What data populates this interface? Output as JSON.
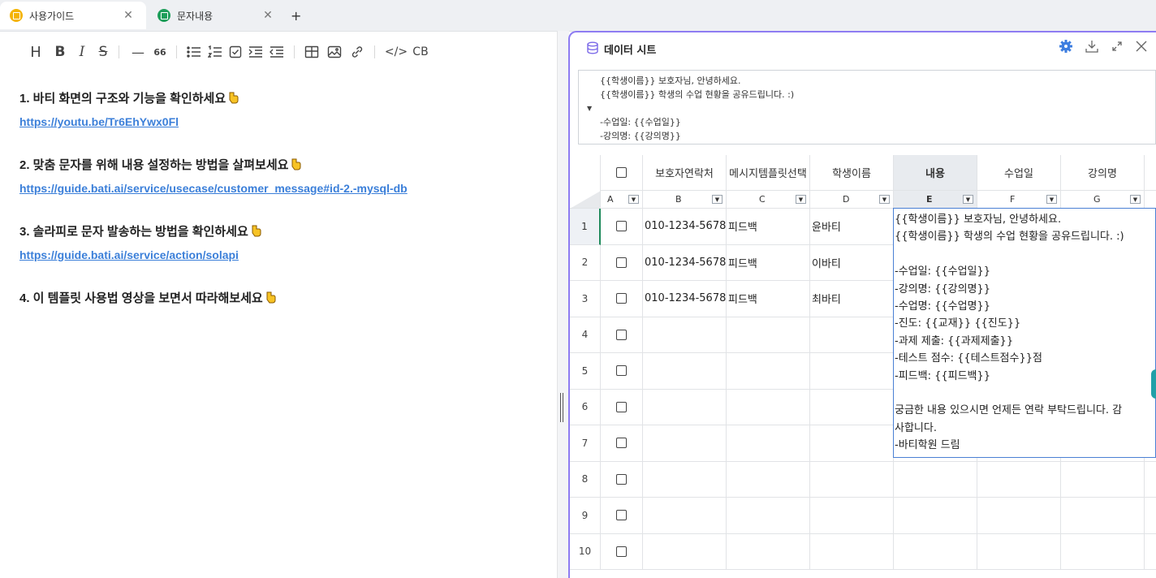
{
  "tabs": [
    {
      "label": "사용가이드",
      "icon": "doc-icon",
      "color": "#f4b400",
      "active": true
    },
    {
      "label": "문자내용",
      "icon": "sheet-icon",
      "color": "#1e9e5a",
      "active": false
    }
  ],
  "toolbar": {
    "heading": "H",
    "bold": "B",
    "italic": "I",
    "strike": "S",
    "hr": "—",
    "quote": "66",
    "code": "</>",
    "codeblock": "CB"
  },
  "doc": {
    "items": [
      {
        "title": "1. 바티 화면의 구조와 기능을 확인하세요",
        "link": "https://youtu.be/Tr6EhYwx0Fl"
      },
      {
        "title": "2. 맞춤 문자를 위해 내용 설정하는 방법을 살펴보세요",
        "link": "https://guide.bati.ai/service/usecase/customer_message#id-2.-mysql-db"
      },
      {
        "title": "3. 솔라피로 문자 발송하는 방법을 확인하세요",
        "link": "https://guide.bati.ai/service/action/solapi"
      },
      {
        "title": "4. 이 템플릿 사용법 영상을 보면서 따라해보세요",
        "link": ""
      }
    ]
  },
  "panel": {
    "title": "데이터 시트",
    "accent": "#8e7cf2",
    "template_lines": [
      "{{학생이름}} 보호자님, 안녕하세요.",
      "{{학생이름}} 학생의 수업 현황을 공유드립니다. :)",
      "",
      "-수업일: {{수업일}}",
      "-강의명: {{강의명}}"
    ]
  },
  "sheet": {
    "headers": [
      "",
      "보호자연락처",
      "메시지템플릿선택",
      "학생이름",
      "내용",
      "수업일",
      "강의명"
    ],
    "letters": [
      "A",
      "B",
      "C",
      "D",
      "E",
      "F",
      "G"
    ],
    "selected_col": "E",
    "rows": [
      {
        "num": "1",
        "phone": "010-1234-5678",
        "template": "피드백",
        "name": "윤바티"
      },
      {
        "num": "2",
        "phone": "010-1234-5678",
        "template": "피드백",
        "name": "이바티"
      },
      {
        "num": "3",
        "phone": "010-1234-5678",
        "template": "피드백",
        "name": "최바티"
      },
      {
        "num": "4",
        "phone": "",
        "template": "",
        "name": ""
      },
      {
        "num": "5",
        "phone": "",
        "template": "",
        "name": ""
      },
      {
        "num": "6",
        "phone": "",
        "template": "",
        "name": ""
      },
      {
        "num": "7",
        "phone": "",
        "template": "",
        "name": ""
      },
      {
        "num": "8",
        "phone": "",
        "template": "",
        "name": ""
      },
      {
        "num": "9",
        "phone": "",
        "template": "",
        "name": ""
      },
      {
        "num": "10",
        "phone": "",
        "template": "",
        "name": ""
      }
    ],
    "cell_editor_lines": [
      "{{학생이름}} 보호자님, 안녕하세요.",
      "{{학생이름}} 학생의 수업 현황을 공유드립니다. :)",
      "",
      "-수업일: {{수업일}}",
      "-강의명: {{강의명}}",
      "-수업명: {{수업명}}",
      "-진도: {{교재}} {{진도}}",
      "-과제 제출: {{과제제출}}",
      "-테스트 점수: {{테스트점수}}점",
      "-피드백: {{피드백}}",
      "",
      "궁금한 내용 있으시면 언제든 연락 부탁드립니다. 감",
      "사합니다.",
      "-바티학원 드림"
    ]
  }
}
